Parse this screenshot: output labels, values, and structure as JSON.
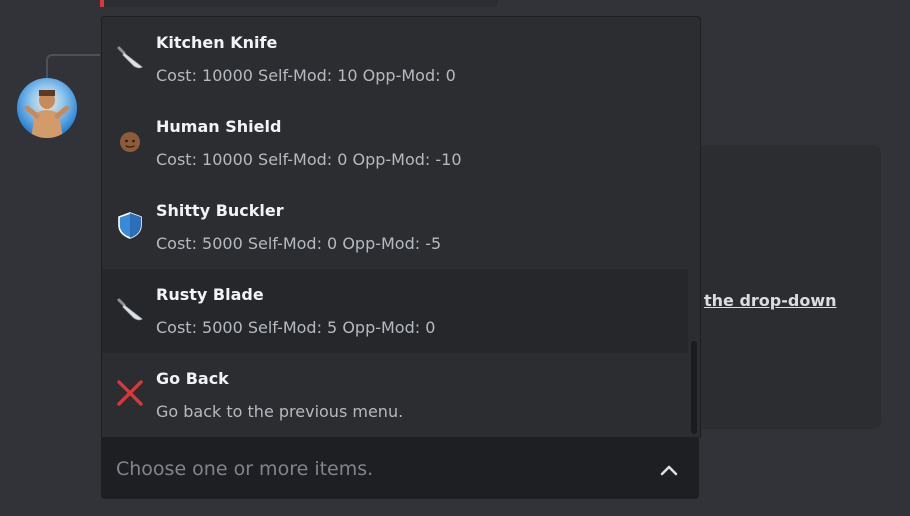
{
  "menu": {
    "options": [
      {
        "label": "Kitchen Knife",
        "description": "Cost: 10000 Self-Mod: 10 Opp-Mod: 0",
        "icon": "knife-icon"
      },
      {
        "label": "Human Shield",
        "description": "Cost: 10000 Self-Mod: 0 Opp-Mod: -10",
        "icon": "person-face-icon"
      },
      {
        "label": "Shitty Buckler",
        "description": "Cost: 5000 Self-Mod: 0 Opp-Mod: -5",
        "icon": "shield-icon"
      },
      {
        "label": "Rusty Blade",
        "description": "Cost: 5000 Self-Mod: 5 Opp-Mod: 0",
        "icon": "knife-icon"
      },
      {
        "label": "Go Back",
        "description": "Go back to the previous menu.",
        "icon": "cross-mark-icon"
      }
    ]
  },
  "select": {
    "placeholder": "Choose one or more items."
  },
  "embed": {
    "link_text": "the drop-down"
  },
  "colors": {
    "background": "#313338",
    "menu_background": "#2b2d31",
    "hover_background": "#26272b",
    "select_background": "#1e1f22",
    "label_text": "#f2f3f5",
    "description_text": "#b5bac1",
    "placeholder_text": "#80848e",
    "danger": "#da373c",
    "shield_blue": "#3b8ad8"
  }
}
